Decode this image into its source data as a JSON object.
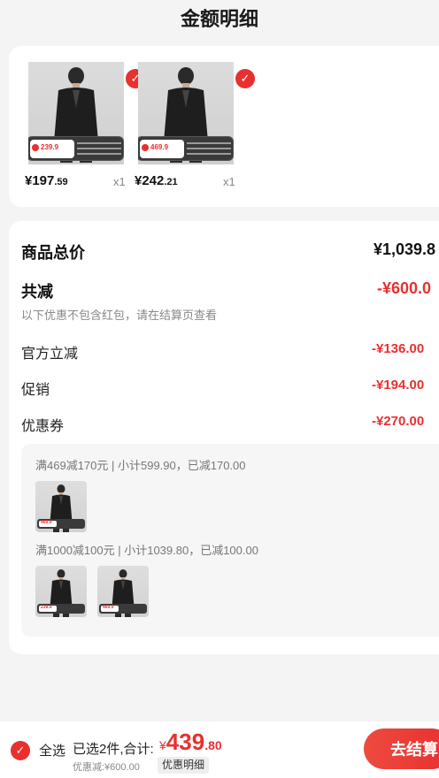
{
  "header": {
    "title": "金额明细"
  },
  "products": [
    {
      "price_int": "¥197",
      "price_dec": ".59",
      "qty": "x1",
      "tag_price": "239.9"
    },
    {
      "price_int": "¥242",
      "price_dec": ".21",
      "qty": "x1",
      "tag_price": "469.9"
    }
  ],
  "detail": {
    "total_label": "商品总价",
    "total_value": "¥1,039.8",
    "reduce_label": "共减",
    "reduce_value": "-¥600.0",
    "reduce_note": "以下优惠不包含红包，请在结算页查看",
    "items": [
      {
        "label": "官方立减",
        "value": "-¥136.00"
      },
      {
        "label": "促销",
        "value": "-¥194.00"
      },
      {
        "label": "优惠券",
        "value": "-¥270.00"
      }
    ],
    "coupons": [
      {
        "text": "满469减170元 | 小计599.90，已减170.00",
        "thumb_prices": [
          "469.9"
        ]
      },
      {
        "text": "满1000减100元 | 小计1039.80，已减100.00",
        "thumb_prices": [
          "239.9",
          "469.9"
        ]
      }
    ]
  },
  "footer": {
    "select_all": "全选",
    "summary": "已选2件,合计:",
    "total_cur": "¥",
    "total_int": "439",
    "total_dec": ".80",
    "discount": "优惠减:¥600.00",
    "detail_button": "优惠明细",
    "checkout": "去结算"
  },
  "colors": {
    "accent": "#e8302f",
    "background": "#f4f4f4",
    "card": "#ffffff"
  }
}
